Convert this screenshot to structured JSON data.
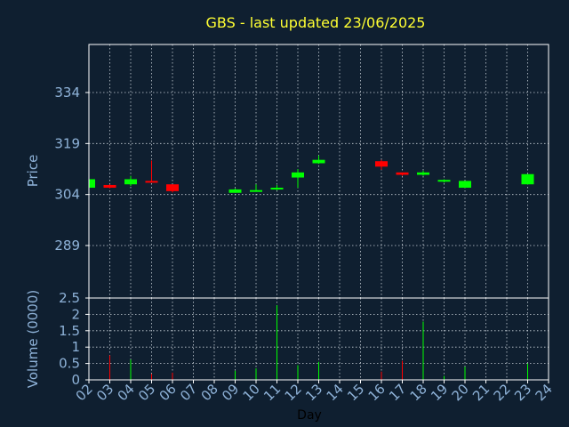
{
  "chart_data": [
    {
      "type": "candlestick",
      "title": "GBS - last updated 23/06/2025",
      "ylabel": "Price",
      "ylim": [
        289,
        334
      ],
      "yticks": [
        "289",
        "304",
        "319",
        "334"
      ],
      "x_categories": [
        "02",
        "03",
        "04",
        "05",
        "06",
        "07",
        "08",
        "09",
        "10",
        "11",
        "12",
        "13",
        "14",
        "15",
        "16",
        "17",
        "18",
        "19",
        "20",
        "21",
        "22",
        "23",
        "24"
      ],
      "grid": true,
      "up_color": "#00ff00",
      "down_color": "#ff0000",
      "candles": [
        {
          "day": "02",
          "open": 306.0,
          "close": 308.5,
          "high": 308.5,
          "low": 306.0
        },
        {
          "day": "03",
          "open": 306.8,
          "close": 306.0,
          "high": 307.0,
          "low": 305.8
        },
        {
          "day": "04",
          "open": 307.0,
          "close": 308.5,
          "high": 309.5,
          "low": 306.5
        },
        {
          "day": "05",
          "open": 308.0,
          "close": 307.5,
          "high": 314.0,
          "low": 307.5
        },
        {
          "day": "06",
          "open": 307.0,
          "close": 305.0,
          "high": 307.0,
          "low": 304.6
        },
        {
          "day": "09",
          "open": 304.5,
          "close": 305.5,
          "high": 305.8,
          "low": 304.5
        },
        {
          "day": "10",
          "open": 304.9,
          "close": 305.3,
          "high": 307.0,
          "low": 304.8
        },
        {
          "day": "11",
          "open": 305.5,
          "close": 306.0,
          "high": 306.8,
          "low": 305.3
        },
        {
          "day": "12",
          "open": 309.0,
          "close": 310.5,
          "high": 311.5,
          "low": 306.0
        },
        {
          "day": "13",
          "open": 313.2,
          "close": 314.2,
          "high": 315.5,
          "low": 313.0
        },
        {
          "day": "16",
          "open": 313.8,
          "close": 312.2,
          "high": 314.2,
          "low": 311.3
        },
        {
          "day": "17",
          "open": 310.5,
          "close": 309.8,
          "high": 310.5,
          "low": 309.5
        },
        {
          "day": "18",
          "open": 309.8,
          "close": 310.5,
          "high": 311.0,
          "low": 309.5
        },
        {
          "day": "19",
          "open": 307.9,
          "close": 308.3,
          "high": 308.5,
          "low": 307.5
        },
        {
          "day": "20",
          "open": 306.0,
          "close": 308.0,
          "high": 308.0,
          "low": 306.0
        },
        {
          "day": "23",
          "open": 307.0,
          "close": 310.0,
          "high": 310.0,
          "low": 307.0
        }
      ]
    },
    {
      "type": "bar",
      "ylabel": "Volume (0000)",
      "xlabel": "Day",
      "ylim": [
        0,
        2.5
      ],
      "yticks": [
        "0",
        "0.5",
        "1",
        "1.5",
        "2",
        "2.5"
      ],
      "grid": true,
      "bars": [
        {
          "day": "03",
          "value": 0.75,
          "color": "#ff0000"
        },
        {
          "day": "04",
          "value": 0.62,
          "color": "#00ff00"
        },
        {
          "day": "05",
          "value": 0.18,
          "color": "#ff0000"
        },
        {
          "day": "06",
          "value": 0.22,
          "color": "#ff0000"
        },
        {
          "day": "09",
          "value": 0.28,
          "color": "#00ff00"
        },
        {
          "day": "10",
          "value": 0.35,
          "color": "#00ff00"
        },
        {
          "day": "11",
          "value": 2.28,
          "color": "#00ff00"
        },
        {
          "day": "12",
          "value": 0.45,
          "color": "#00ff00"
        },
        {
          "day": "13",
          "value": 0.55,
          "color": "#00ff00"
        },
        {
          "day": "16",
          "value": 0.25,
          "color": "#ff0000"
        },
        {
          "day": "17",
          "value": 0.58,
          "color": "#ff0000"
        },
        {
          "day": "18",
          "value": 1.78,
          "color": "#00ff00"
        },
        {
          "day": "19",
          "value": 0.12,
          "color": "#00ff00"
        },
        {
          "day": "20",
          "value": 0.4,
          "color": "#00ff00"
        },
        {
          "day": "23",
          "value": 0.5,
          "color": "#00ff00"
        }
      ]
    }
  ]
}
